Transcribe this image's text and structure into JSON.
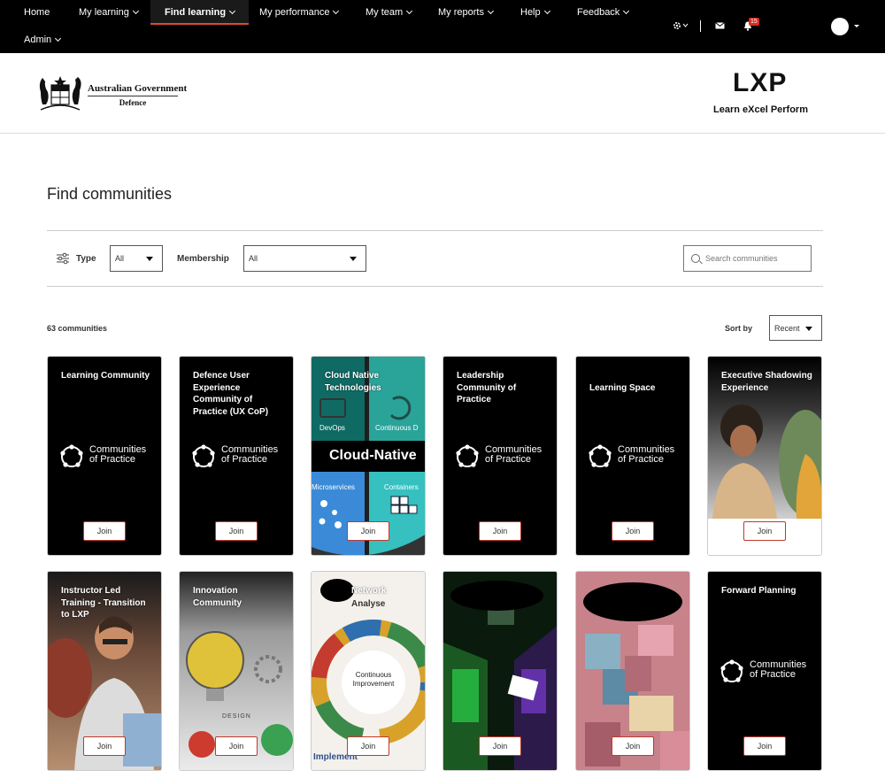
{
  "nav": {
    "items": [
      {
        "label": "Home"
      },
      {
        "label": "My learning"
      },
      {
        "label": "Find learning"
      },
      {
        "label": "My performance"
      },
      {
        "label": "My team"
      },
      {
        "label": "My reports"
      },
      {
        "label": "Help"
      },
      {
        "label": "Feedback"
      },
      {
        "label": "Admin"
      }
    ],
    "notifications_count": "15"
  },
  "header": {
    "gov_name": "Australian Government",
    "dept": "Defence",
    "logo": "LXP",
    "tagline": "Learn eXcel Perform"
  },
  "page": {
    "title": "Find communities",
    "count": "63 communities",
    "sort_label": "Sort by",
    "sort_value": "Recent"
  },
  "filters": {
    "type_label": "Type",
    "type_value": "All",
    "membership_label": "Membership",
    "membership_value": "All",
    "search_placeholder": "Search communities"
  },
  "cop_logo": {
    "line1": "Communities",
    "line2": "of Practice"
  },
  "join_label": "Join",
  "cards": [
    {
      "title": "Learning Community",
      "style": "cop"
    },
    {
      "title": "Defence User Experience Community of Practice (UX CoP)",
      "style": "cop"
    },
    {
      "title": "Cloud Native Technologies",
      "style": "cloud",
      "center": "Cloud-Native",
      "q1": "DevOps",
      "q2": "Continuous D",
      "q3": "Microservices",
      "q4": "Containers"
    },
    {
      "title": "Leadership Community of Practice",
      "style": "cop"
    },
    {
      "title": "Learning Space",
      "style": "cop"
    },
    {
      "title": "Executive Shadowing Experience",
      "style": "photo-woman"
    },
    {
      "title": "Instructor Led Training - Transition to LXP",
      "style": "photo-man"
    },
    {
      "title": "Innovation Community",
      "style": "innovation",
      "word": "DESIGN"
    },
    {
      "title": "Network",
      "style": "cycle",
      "w1": "Analyse",
      "w2": "Continuous Improvement",
      "w3": "Implement"
    },
    {
      "title": "",
      "style": "server"
    },
    {
      "title": "",
      "style": "blocks"
    },
    {
      "title": "Forward Planning",
      "style": "cop"
    }
  ],
  "colors": {
    "accent": "#e0492c",
    "nav_bg": "#000000",
    "join_border": "#c0392b"
  }
}
